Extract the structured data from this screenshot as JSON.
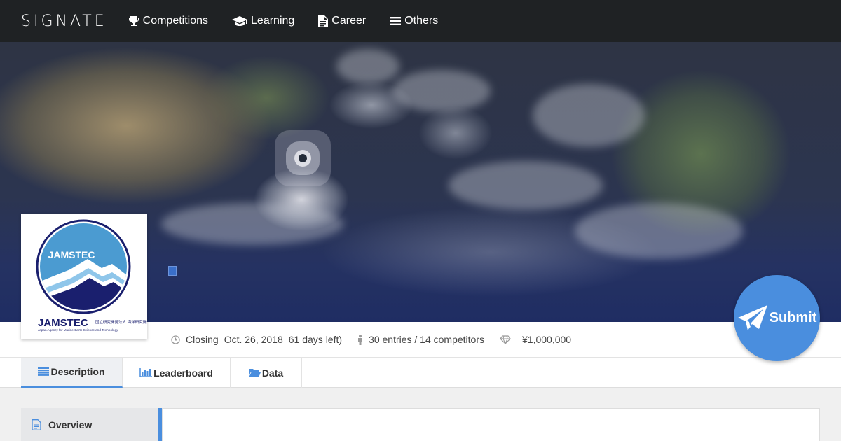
{
  "nav": {
    "logo": "SIGNATE",
    "items": [
      {
        "label": "Competitions",
        "icon": "trophy-icon"
      },
      {
        "label": "Learning",
        "icon": "graduation-cap-icon"
      },
      {
        "label": "Career",
        "icon": "document-icon"
      },
      {
        "label": "Others",
        "icon": "menu-icon"
      }
    ]
  },
  "org": {
    "name": "JAMSTEC",
    "subtitle_jp": "国立研究開発法人 海洋研究開発機構",
    "subtitle_en": "Japan Agency for Marine-Earth Science and Technology"
  },
  "info": {
    "closing_label": "Closing",
    "closing_date": "Oct. 26, 2018",
    "days_left": "61 days left)",
    "entries": "30 entries / 14 competitors",
    "prize": "¥1,000,000"
  },
  "submit_label": "Submit",
  "tabs": [
    {
      "label": "Description",
      "icon": "list-icon",
      "active": true
    },
    {
      "label": "Leaderboard",
      "icon": "bar-chart-icon",
      "active": false
    },
    {
      "label": "Data",
      "icon": "folder-open-icon",
      "active": false
    }
  ],
  "side_menu": {
    "label": "Overview",
    "icon": "file-icon"
  },
  "colors": {
    "accent": "#4a8ede",
    "nav_bg": "#1f2224",
    "jamstec_navy": "#1a1f6e"
  }
}
